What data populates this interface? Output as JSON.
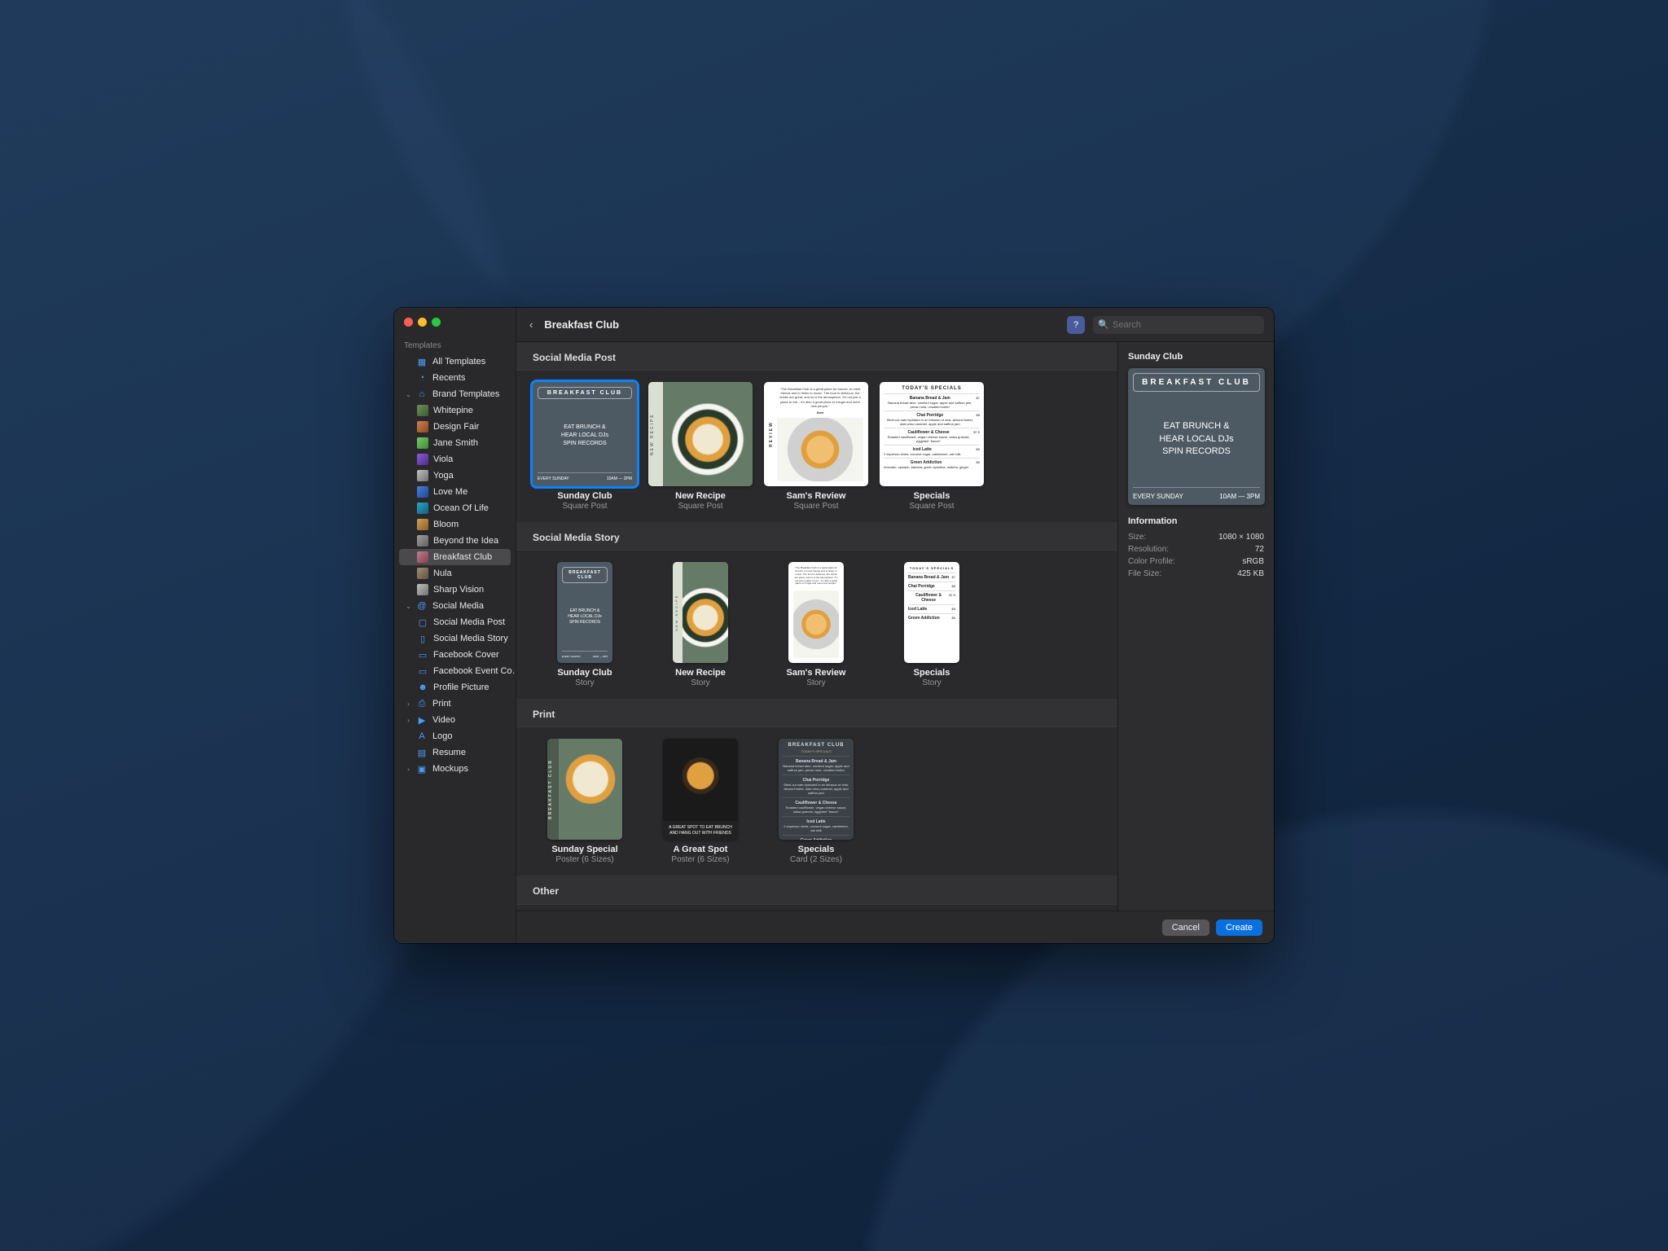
{
  "header": {
    "back_title": "Breakfast Club",
    "search_placeholder": "Search"
  },
  "sidebar": {
    "section_label": "Templates",
    "all": "All Templates",
    "recents": "Recents",
    "brand_label": "Brand Templates",
    "brand_items": [
      "Whitepine",
      "Design Fair",
      "Jane Smith",
      "Viola",
      "Yoga",
      "Love Me",
      "Ocean Of Life",
      "Bloom",
      "Beyond the Idea",
      "Breakfast Club",
      "Nula",
      "Sharp Vision"
    ],
    "social_label": "Social Media",
    "social_items": [
      "Social Media Post",
      "Social Media Story",
      "Facebook Cover",
      "Facebook Event Co…",
      "Profile Picture"
    ],
    "extra": [
      "Print",
      "Video",
      "Logo",
      "Resume",
      "Mockups"
    ]
  },
  "sections": {
    "post": "Social Media Post",
    "story": "Social Media Story",
    "print": "Print",
    "other": "Other"
  },
  "posts": [
    {
      "name": "Sunday Club",
      "sub": "Square Post",
      "selected": true
    },
    {
      "name": "New Recipe",
      "sub": "Square Post"
    },
    {
      "name": "Sam's Review",
      "sub": "Square Post"
    },
    {
      "name": "Specials",
      "sub": "Square Post"
    }
  ],
  "stories": [
    {
      "name": "Sunday Club",
      "sub": "Story"
    },
    {
      "name": "New Recipe",
      "sub": "Story"
    },
    {
      "name": "Sam's Review",
      "sub": "Story"
    },
    {
      "name": "Specials",
      "sub": "Story"
    }
  ],
  "prints": [
    {
      "name": "Sunday Special",
      "sub": "Poster (6 Sizes)"
    },
    {
      "name": "A Great Spot",
      "sub": "Poster (6 Sizes)"
    },
    {
      "name": "Specials",
      "sub": "Card (2 Sizes)"
    }
  ],
  "art": {
    "bc_header": "BREAKFAST CLUB",
    "bc_line1": "EAT BRUNCH &",
    "bc_line2": "HEAR LOCAL DJs",
    "bc_line3": "SPIN RECORDS",
    "bc_foot_l": "EVERY SUNDAY",
    "bc_foot_r": "10AM — 3PM",
    "recipe_strip": "NEW RECIPE",
    "review_strip": "REVIEW",
    "review_text": "\"The Breakfast Club is a great place for brunch, to meet friends and to listen to music. The food is delicious, the drinks are great, and so is the atmosphere. It's not just a place to eat – it's also a great place to mingle and meet new people.\"",
    "review_author": "Sam",
    "menu_title": "TODAY'S SPECIALS",
    "menu_items": [
      {
        "n": "Banana Bread & Jam",
        "d": "Banana bread slice, smoked sugar, apple and saffron jam, pecan nuts, unsalted butter",
        "p": "$7"
      },
      {
        "n": "Chai Porridge",
        "d": "Steel-cut oats hydrated in an infusion of chai, almond butter, date-miso caramel, apple and saffron jam",
        "p": "$8"
      },
      {
        "n": "Cauliflower & Cheese",
        "d": "Roasted cauliflower, vegan cheese sauce, salsa granola, eggplant \"bacon\"",
        "p": "$7.5"
      },
      {
        "n": "Iced Latte",
        "d": "2 espresso shots, coconut sugar, cardamom, oat milk",
        "p": "$5"
      },
      {
        "n": "Green Addiction",
        "d": "Avocado, spinach, banana, green spirulina, matcha, ginger",
        "p": "$6"
      }
    ],
    "spot_caption": "A GREAT SPOT TO EAT BRUNCH AND HANG OUT WITH FRIENDS",
    "special_strip": "BREAKFAST CLUB"
  },
  "info": {
    "title": "Sunday Club",
    "section": "Information",
    "rows": [
      {
        "k": "Size:",
        "v": "1080 × 1080"
      },
      {
        "k": "Resolution:",
        "v": "72"
      },
      {
        "k": "Color Profile:",
        "v": "sRGB"
      },
      {
        "k": "File Size:",
        "v": "425 KB"
      }
    ]
  },
  "footer": {
    "cancel": "Cancel",
    "create": "Create"
  }
}
